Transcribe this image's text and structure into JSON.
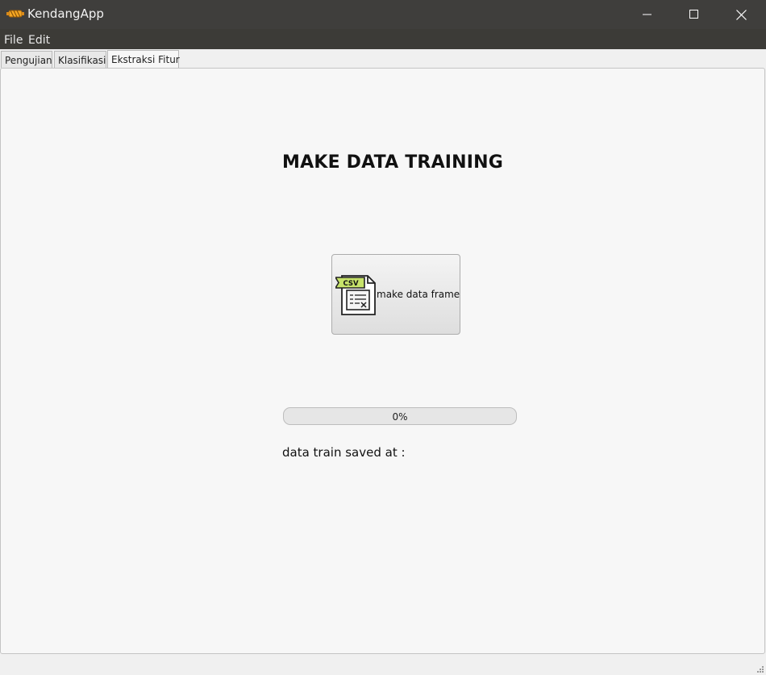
{
  "window": {
    "title": "KendangApp",
    "icon": "drum-icon",
    "controls": [
      "minimize-icon",
      "maximize-icon",
      "close-icon"
    ]
  },
  "menu": {
    "items": [
      "File",
      "Edit"
    ]
  },
  "tabs": [
    {
      "label": "Pengujian",
      "active": false
    },
    {
      "label": "Klasifikasi",
      "active": false
    },
    {
      "label": "Ekstraksi Fitur",
      "active": true
    }
  ],
  "main": {
    "heading": "MAKE DATA TRAINING",
    "button": {
      "label": "make data frame",
      "icon": "csv-file-icon",
      "icon_text": "CSV"
    },
    "progress": {
      "value": 0,
      "text": "0%"
    },
    "saved_label": "data train saved at :"
  },
  "colors": {
    "titlebar": "#3f3e3c",
    "menubar": "#3c3b37",
    "icon_accent": "#f5a623",
    "csv_tag": "#c7e36a"
  }
}
